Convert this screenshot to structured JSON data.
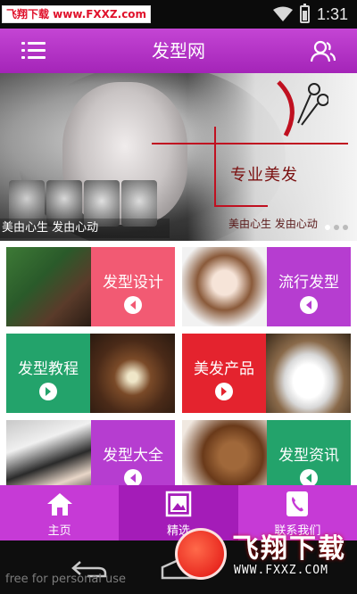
{
  "status_bar": {
    "watermark": "飞翔下载 www.FXXZ.com",
    "time": "1:31",
    "icons": [
      "wifi-icon",
      "battery-icon"
    ]
  },
  "header": {
    "title": "发型网",
    "left_icon": "menu-icon",
    "right_icon": "user-icon"
  },
  "banner": {
    "slogan": "专业美发",
    "subslogan": "美由心生 发由心动",
    "caption": "美由心生 发由心动",
    "slide_count": 3,
    "active_slide": 1
  },
  "tiles": [
    {
      "label": "发型设计",
      "color": "#f25a73",
      "photo_side": "left"
    },
    {
      "label": "流行发型",
      "color": "#b63dd0",
      "photo_side": "left"
    },
    {
      "label": "发型教程",
      "color": "#23a36b",
      "photo_side": "right"
    },
    {
      "label": "美发产品",
      "color": "#e4232e",
      "photo_side": "right"
    },
    {
      "label": "发型大全",
      "color": "#b63dd0",
      "photo_side": "left"
    },
    {
      "label": "发型资讯",
      "color": "#23a36b",
      "photo_side": "left"
    }
  ],
  "bottom_nav": {
    "items": [
      {
        "label": "主页",
        "icon": "house-icon"
      },
      {
        "label": "精选",
        "icon": "picture-icon"
      },
      {
        "label": "联系我们",
        "icon": "phone-icon"
      }
    ],
    "color": "#c63ad6"
  },
  "system_nav": {
    "note": "free for personal use"
  },
  "logo_watermark": {
    "text": "飞翔下载",
    "url": "WWW.FXXZ.COM"
  }
}
